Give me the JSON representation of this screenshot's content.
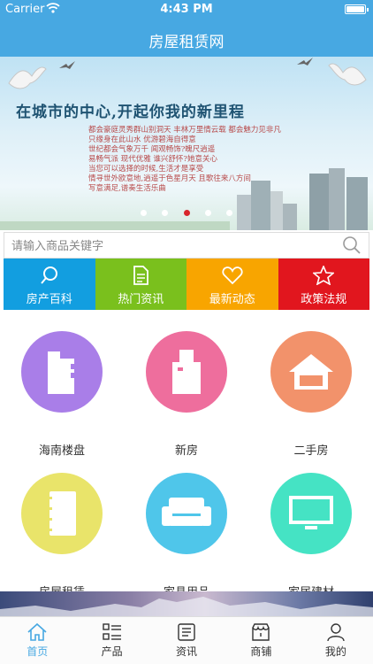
{
  "status_bar": {
    "carrier": "Carrier",
    "time": "4:43 PM"
  },
  "nav": {
    "title": "房屋租赁网"
  },
  "banner": {
    "headline": "在城市的中心,开起你我的新里程",
    "poem": [
      "都会豪庭灵秀群山别洞天  丰林万里情云载  都会魅力见非凡",
      "只缘身在此山水  优游碧海自得意",
      "世纪都会气象万千  闻观畅饰?魄尺逍遥",
      "易畅气派  现代优雅  谁兴舒怀?她意关心",
      "当您可以选择的时候,生活才是享受",
      "情寻世外欧意地,逍遥于色星月天  且歌往来八方间",
      "写意满足,谱奏生活乐曲"
    ],
    "slide_count": 5,
    "active_slide": 2,
    "active_dot_color": "#d8262c"
  },
  "search": {
    "placeholder": "请输入商品关键字",
    "value": ""
  },
  "quick_links": [
    {
      "label": "房产百科",
      "icon": "search-icon",
      "color": "#129ee0"
    },
    {
      "label": "热门资讯",
      "icon": "document-icon",
      "color": "#7ac01d"
    },
    {
      "label": "最新动态",
      "icon": "heart-icon",
      "color": "#f8a500"
    },
    {
      "label": "政策法规",
      "icon": "star-icon",
      "color": "#e1161e"
    }
  ],
  "categories": [
    {
      "label": "海南楼盘",
      "icon": "buildings-icon",
      "color": "#a97ee8"
    },
    {
      "label": "新房",
      "icon": "building-icon",
      "color": "#ee6e9d"
    },
    {
      "label": "二手房",
      "icon": "house-icon",
      "color": "#f2926b"
    },
    {
      "label": "房屋租赁",
      "icon": "notebook-icon",
      "color": "#e9e46a"
    },
    {
      "label": "家具用品",
      "icon": "sofa-icon",
      "color": "#4fc6ea"
    },
    {
      "label": "家居建材",
      "icon": "monitor-icon",
      "color": "#45e3c4"
    }
  ],
  "tabs": [
    {
      "label": "首页",
      "icon": "home-icon",
      "active": true
    },
    {
      "label": "产品",
      "icon": "list-icon",
      "active": false
    },
    {
      "label": "资讯",
      "icon": "news-icon",
      "active": false
    },
    {
      "label": "商铺",
      "icon": "shop-icon",
      "active": false
    },
    {
      "label": "我的",
      "icon": "user-icon",
      "active": false
    }
  ],
  "colors": {
    "brand": "#47a8e2",
    "active_tab": "#47a8e2"
  }
}
